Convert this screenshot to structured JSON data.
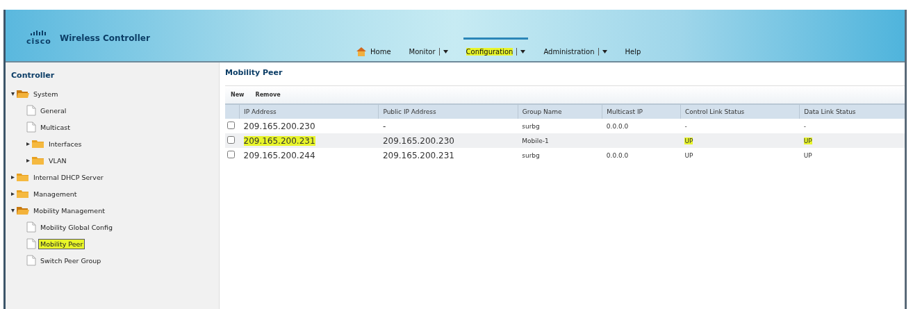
{
  "header": {
    "logo": "cisco",
    "product": "Wireless Controller",
    "nav": [
      {
        "label": "Home",
        "kind": "home",
        "selected": false,
        "highlighted": false,
        "dropdown": false
      },
      {
        "label": "Monitor",
        "kind": "menu",
        "selected": false,
        "highlighted": false,
        "dropdown": true
      },
      {
        "label": "Configuration",
        "kind": "menu",
        "selected": true,
        "highlighted": true,
        "dropdown": true
      },
      {
        "label": "Administration",
        "kind": "menu",
        "selected": false,
        "highlighted": false,
        "dropdown": true
      },
      {
        "label": "Help",
        "kind": "menu",
        "selected": false,
        "highlighted": false,
        "dropdown": false
      }
    ]
  },
  "sidebar": {
    "title": "Controller",
    "items": [
      {
        "label": "System",
        "kind": "folder",
        "expanded": true,
        "selected": false,
        "highlighted": false,
        "children": [
          {
            "label": "General",
            "kind": "page",
            "selected": false,
            "highlighted": false
          },
          {
            "label": "Multicast",
            "kind": "page",
            "selected": false,
            "highlighted": false
          },
          {
            "label": "Interfaces",
            "kind": "folder",
            "expanded": false,
            "selected": false,
            "highlighted": false
          },
          {
            "label": "VLAN",
            "kind": "folder",
            "expanded": false,
            "selected": false,
            "highlighted": false
          }
        ]
      },
      {
        "label": "Internal DHCP Server",
        "kind": "folder",
        "expanded": false,
        "selected": false,
        "highlighted": false
      },
      {
        "label": "Management",
        "kind": "folder",
        "expanded": false,
        "selected": false,
        "highlighted": false
      },
      {
        "label": "Mobility Management",
        "kind": "folder",
        "expanded": true,
        "selected": false,
        "highlighted": false,
        "children": [
          {
            "label": "Mobility Global Config",
            "kind": "page",
            "selected": false,
            "highlighted": false
          },
          {
            "label": "Mobility Peer",
            "kind": "page",
            "selected": true,
            "highlighted": true
          },
          {
            "label": "Switch Peer Group",
            "kind": "page",
            "selected": false,
            "highlighted": false
          }
        ]
      }
    ]
  },
  "main": {
    "title": "Mobility Peer",
    "toolbar": [
      "New",
      "Remove"
    ],
    "table": {
      "columns": [
        "IP Address",
        "Public IP Address",
        "Group Name",
        "Multicast IP",
        "Control Link Status",
        "Data Link Status"
      ],
      "rows": [
        {
          "checked": false,
          "cells": [
            {
              "text": "209.165.200.230",
              "highlighted": false
            },
            {
              "text": "-",
              "highlighted": false
            },
            {
              "text": "surbg",
              "highlighted": false
            },
            {
              "text": "0.0.0.0",
              "highlighted": false
            },
            {
              "text": "-",
              "highlighted": false
            },
            {
              "text": "-",
              "highlighted": false
            }
          ]
        },
        {
          "checked": false,
          "cells": [
            {
              "text": "209.165.200.231",
              "highlighted": true
            },
            {
              "text": "209.165.200.230",
              "highlighted": false
            },
            {
              "text": "Mobile-1",
              "highlighted": false
            },
            {
              "highlighted": false
            },
            {
              "text": "UP",
              "highlighted": true
            },
            {
              "text": "UP",
              "highlighted": true
            }
          ]
        },
        {
          "checked": false,
          "cells": [
            {
              "text": "209.165.200.244",
              "highlighted": false
            },
            {
              "text": "209.165.200.231",
              "highlighted": false
            },
            {
              "text": "surbg",
              "highlighted": false
            },
            {
              "text": "0.0.0.0",
              "highlighted": false
            },
            {
              "text": "UP",
              "highlighted": false
            },
            {
              "text": "UP",
              "highlighted": false
            }
          ]
        }
      ]
    }
  }
}
